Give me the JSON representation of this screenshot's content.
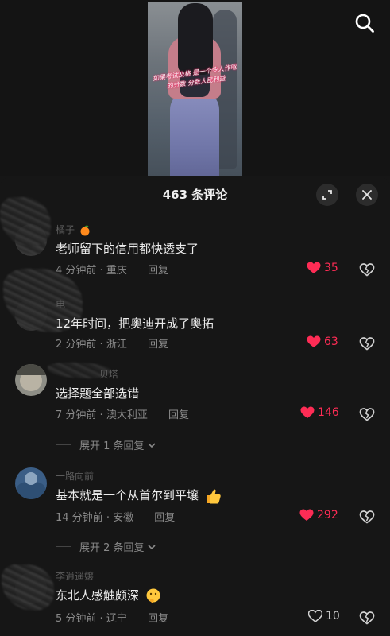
{
  "video": {
    "caption": "如果考试及格 是一个令人作呕的分数 分数人民利益"
  },
  "panel": {
    "title": "463 条评论"
  },
  "comments": [
    {
      "username": "橘子",
      "text": "老师留下的信用都快透支了",
      "time": "4 分钟前",
      "location": "重庆",
      "reply_label": "回复",
      "likes": "35",
      "liked": true
    },
    {
      "username": "电",
      "text": "12年时间，把奥迪开成了奥拓",
      "time": "2 分钟前",
      "location": "浙江",
      "reply_label": "回复",
      "likes": "63",
      "liked": true
    },
    {
      "username": "贝塔",
      "text": "选择题全部选错",
      "time": "7 分钟前",
      "location": "澳大利亚",
      "reply_label": "回复",
      "likes": "146",
      "liked": true,
      "expand_label": "展开 1 条回复"
    },
    {
      "username": "一路向前",
      "text": "基本就是一个从首尔到平壤",
      "time": "14 分钟前",
      "location": "安徽",
      "reply_label": "回复",
      "likes": "292",
      "liked": true,
      "expand_label": "展开 2 条回复"
    },
    {
      "username": "李逍遥嬢",
      "text": "东北人感触颇深",
      "time": "5 分钟前",
      "location": "辽宁",
      "reply_label": "回复",
      "likes": "10",
      "liked": false
    }
  ],
  "meta_separator": "·",
  "colors": {
    "like_active": "#fe2c55",
    "panel_bg": "#161616",
    "muted_text": "#8a8a8a"
  },
  "icons": [
    "search-icon",
    "expand-icon",
    "close-icon",
    "heart-icon",
    "heart-outline-icon",
    "broken-heart-icon",
    "chevron-down-icon",
    "orange-emoji",
    "thumbs-up-emoji",
    "thinking-emoji"
  ]
}
